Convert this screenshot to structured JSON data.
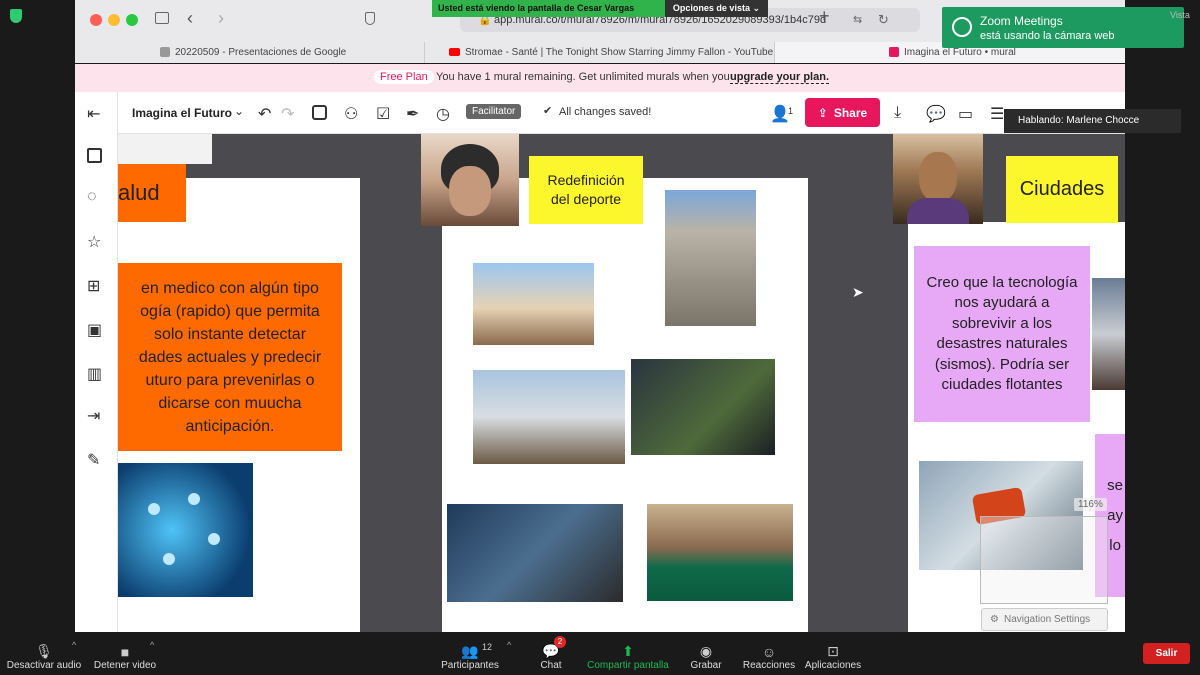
{
  "share_notice": {
    "text": "Usted está viendo la pantalla de Cesar Vargas",
    "options": "Opciones de vista ⌄"
  },
  "browser": {
    "url": "app.mural.co/t/mural78926/m/mural78926/1652029089393/1b4c79d",
    "tabs": [
      "20220509 - Presentaciones de Google",
      "Stromae - Santé | The Tonight Show Starring Jimmy Fallon - YouTube",
      "Imagina el Futuro • mural"
    ]
  },
  "banner": {
    "plan": "Free Plan",
    "text": "You have 1 mural remaining. Get unlimited murals when you",
    "link": "upgrade your plan."
  },
  "mural": {
    "title": "Imagina el Futuro",
    "facilitator": "Facilitator",
    "saved": "All changes saved!",
    "users_count": "1",
    "share": "Share"
  },
  "zoom_notice": {
    "title": "Zoom Meetings",
    "subtitle": "está usando la cámara web"
  },
  "vista": "Vista",
  "speaking": "Hablando: Marlene Chocce",
  "canvas": {
    "left_title": "alud",
    "left_note": "en medico con algún tipo\nogía (rapido) que permita\nsolo instante detectar\ndades actuales y predecir\nuturo para prevenirlas o\ndicarse con muucha\nanticipación.",
    "mid_title": "Redefinición del deporte",
    "right_title": "Ciudades",
    "right_note": "Creo que la tecnología nos ayudará a sobrevivir a los desastres naturales (sismos). Podría ser ciudades flotantes",
    "partial_note": "se\nay\nlo",
    "zoom_level": "116%",
    "nav_settings": "Navigation Settings"
  },
  "zoom_bar": {
    "mute": "Desactivar audio",
    "video": "Detener video",
    "participants": "Participantes",
    "participants_count": "12",
    "chat": "Chat",
    "chat_badge": "2",
    "share": "Compartir pantalla",
    "record": "Grabar",
    "reactions": "Reacciones",
    "apps": "Aplicaciones",
    "leave": "Salir"
  },
  "colors": {
    "accent": "#e8175d",
    "zoom_green": "#1db954",
    "sticky_orange": "#ff6a00",
    "sticky_yellow": "#fcf72c",
    "sticky_purple": "#e7a8f5"
  }
}
